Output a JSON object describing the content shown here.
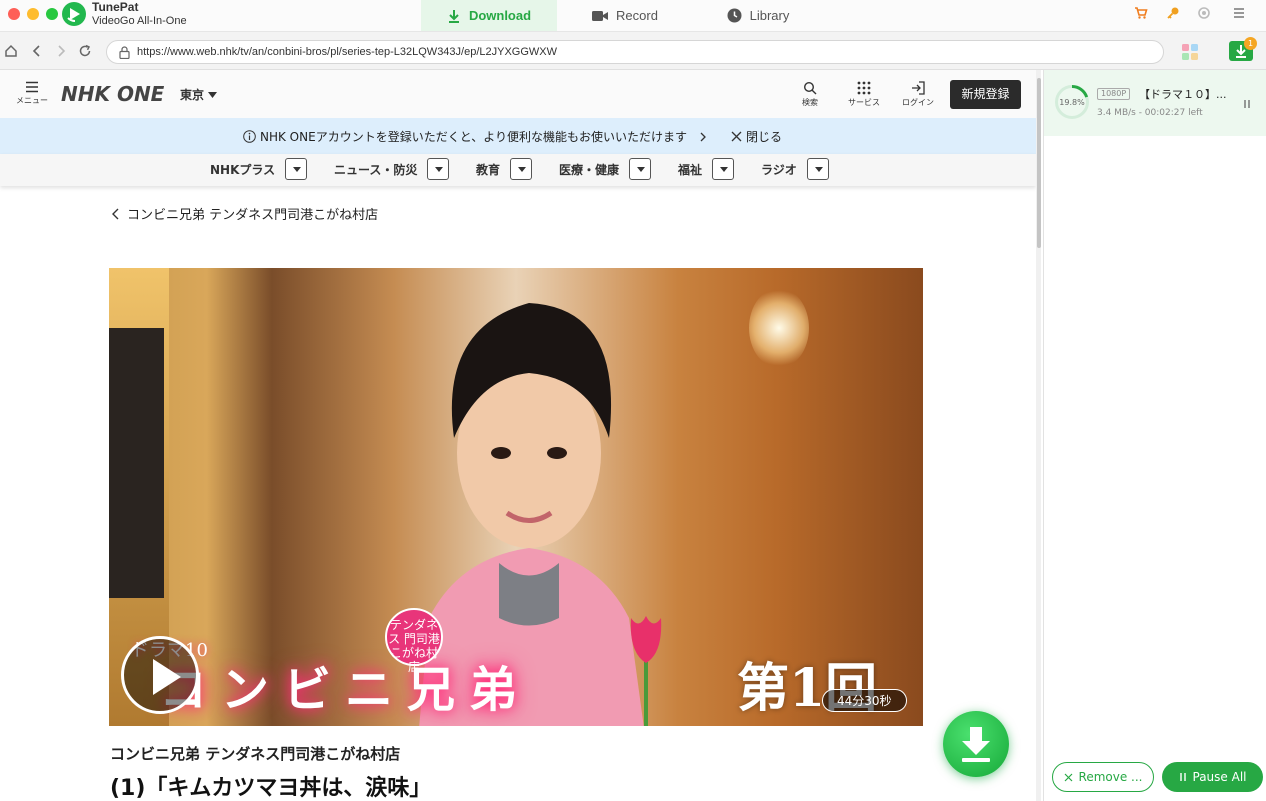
{
  "app": {
    "name": "TunePat",
    "subtitle": "VideoGo All-In-One",
    "accent": "#27a844"
  },
  "tabs": [
    {
      "label": "Download",
      "icon": "download-icon",
      "active": true
    },
    {
      "label": "Record",
      "icon": "camera-icon",
      "active": false
    },
    {
      "label": "Library",
      "icon": "clock-icon",
      "active": false
    }
  ],
  "toolbar_badge": "1",
  "address": {
    "url": "https://www.web.nhk/tv/an/conbini-bros/pl/series-tep-L32LQW343J/ep/L2JYXGGWXW"
  },
  "nhk": {
    "menu_label": "メニュー",
    "logo_text": "NHK ONE",
    "region": "東京",
    "search_label": "検索",
    "services_label": "サービス",
    "login_label": "ログイン",
    "register_label": "新規登録",
    "banner_text": "NHK ONEアカウントを登録いただくと、より便利な機能もお使いいただけます",
    "banner_close": "閉じる",
    "categories": [
      "NHKプラス",
      "ニュース・防災",
      "教育",
      "医療・健康",
      "福祉",
      "ラジオ"
    ],
    "breadcrumb": "コンビニ兄弟 テンダネス門司港こがね村店",
    "video": {
      "small_title": "ドラマ10",
      "title_overlay": "コンビニ兄弟",
      "stamp_text": "テンダネス 門司港 こがね村店",
      "episode_overlay": "第1回",
      "duration": "44分30秒"
    },
    "series_title": "コンビニ兄弟 テンダネス門司港こがね村店",
    "episode_title": "(1)「キムカツマヨ丼は、涙味」"
  },
  "downloads": {
    "items": [
      {
        "progress_percent": 19.8,
        "progress_label": "19.8%",
        "quality": "1080P",
        "title": "【ドラマ１０】...",
        "status": "3.4 MB/s - 00:02:27 left"
      }
    ],
    "remove_label": "Remove ...",
    "pause_all_label": "Pause All"
  }
}
